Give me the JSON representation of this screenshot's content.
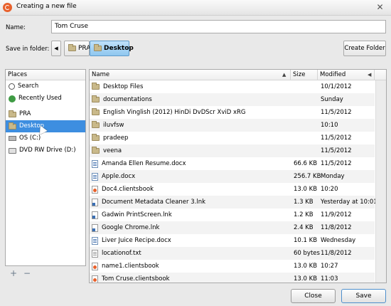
{
  "window": {
    "title": "Creating a new file",
    "close_glyph": "✕"
  },
  "name_field": {
    "label": "Name:",
    "value": "Tom Cruse"
  },
  "save_in": {
    "label": "Save in folder:",
    "back_glyph": "◀",
    "breadcrumbs": [
      "PRA",
      "Desktop"
    ],
    "create_folder_label": "Create Folder"
  },
  "places": {
    "header": "Places",
    "items": [
      {
        "label": "Search",
        "icon": "search-icon"
      },
      {
        "label": "Recently Used",
        "icon": "recent-icon"
      },
      {
        "label": "PRA",
        "icon": "folder-icon"
      },
      {
        "label": "Desktop",
        "icon": "folder-icon",
        "selected": true
      },
      {
        "label": "OS (C:)",
        "icon": "drive-icon"
      },
      {
        "label": "DVD RW Drive (D:)",
        "icon": "dvd-icon"
      }
    ],
    "add_glyph": "+",
    "remove_glyph": "−"
  },
  "files": {
    "columns": {
      "name": "Name",
      "size": "Size",
      "modified": "Modified"
    },
    "sort_arrow": "▲",
    "modified_arrow": "◀",
    "rows": [
      {
        "name": "Desktop Files",
        "size": "",
        "modified": "10/1/2012",
        "type": "folder"
      },
      {
        "name": "documentations",
        "size": "",
        "modified": "Sunday",
        "type": "folder"
      },
      {
        "name": "English Vinglish (2012) HinDi DvDScr XviD xRG",
        "size": "",
        "modified": "11/5/2012",
        "type": "folder"
      },
      {
        "name": "iluvfsw",
        "size": "",
        "modified": "10:10",
        "type": "folder"
      },
      {
        "name": "pradeep",
        "size": "",
        "modified": "11/5/2012",
        "type": "folder"
      },
      {
        "name": "veena",
        "size": "",
        "modified": "11/5/2012",
        "type": "folder"
      },
      {
        "name": "Amanda Ellen Resume.docx",
        "size": "66.6 KB",
        "modified": "11/5/2012",
        "type": "doc"
      },
      {
        "name": "Apple.docx",
        "size": "256.7 KB",
        "modified": "Monday",
        "type": "doc"
      },
      {
        "name": "Doc4.clientsbook",
        "size": "13.0 KB",
        "modified": "10:20",
        "type": "cb"
      },
      {
        "name": "Document Metadata Cleaner 3.lnk",
        "size": "1.3 KB",
        "modified": "Yesterday at 10:01",
        "type": "lnk"
      },
      {
        "name": "Gadwin PrintScreen.lnk",
        "size": "1.2 KB",
        "modified": "11/9/2012",
        "type": "lnk"
      },
      {
        "name": "Google Chrome.lnk",
        "size": "2.4 KB",
        "modified": "11/8/2012",
        "type": "lnk"
      },
      {
        "name": "Liver Juice Recipe.docx",
        "size": "10.1 KB",
        "modified": "Wednesday",
        "type": "doc"
      },
      {
        "name": "locationof.txt",
        "size": "60 bytes",
        "modified": "11/8/2012",
        "type": "txt"
      },
      {
        "name": "name1.clientsbook",
        "size": "13.0 KB",
        "modified": "10:27",
        "type": "cb"
      },
      {
        "name": "Tom Cruse.clientsbook",
        "size": "13.0 KB",
        "modified": "11:03",
        "type": "cb"
      }
    ]
  },
  "buttons": {
    "close": "Close",
    "save": "Save"
  }
}
